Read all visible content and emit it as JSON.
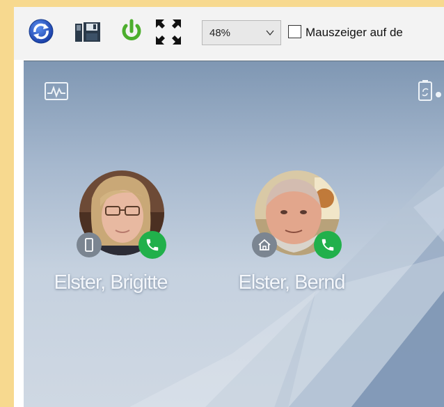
{
  "toolbar": {
    "buttons": [
      {
        "name": "refresh-button",
        "icon": "refresh-icon"
      },
      {
        "name": "save-button",
        "icon": "save-icon"
      },
      {
        "name": "power-button",
        "icon": "power-icon"
      },
      {
        "name": "fullscreen-button",
        "icon": "fullscreen-icon"
      }
    ],
    "zoom": {
      "value": "48%",
      "icon": "chevron-down-icon"
    },
    "pointer_checkbox": {
      "label": "Mauszeiger auf de",
      "checked": false
    }
  },
  "phone": {
    "status_icons": [
      "activity-icon",
      "battery-icon"
    ],
    "contacts": [
      {
        "name": "Elster, Brigitte",
        "type_icon": "mobile-phone-icon",
        "call_icon": "phone-icon"
      },
      {
        "name": "Elster, Bernd",
        "type_icon": "home-icon",
        "call_icon": "phone-icon"
      }
    ]
  },
  "colors": {
    "page_border": "#f7d98f",
    "toolbar_bg": "#f3f3f3",
    "call_badge": "#21b04b",
    "type_badge": "#7b8591"
  }
}
